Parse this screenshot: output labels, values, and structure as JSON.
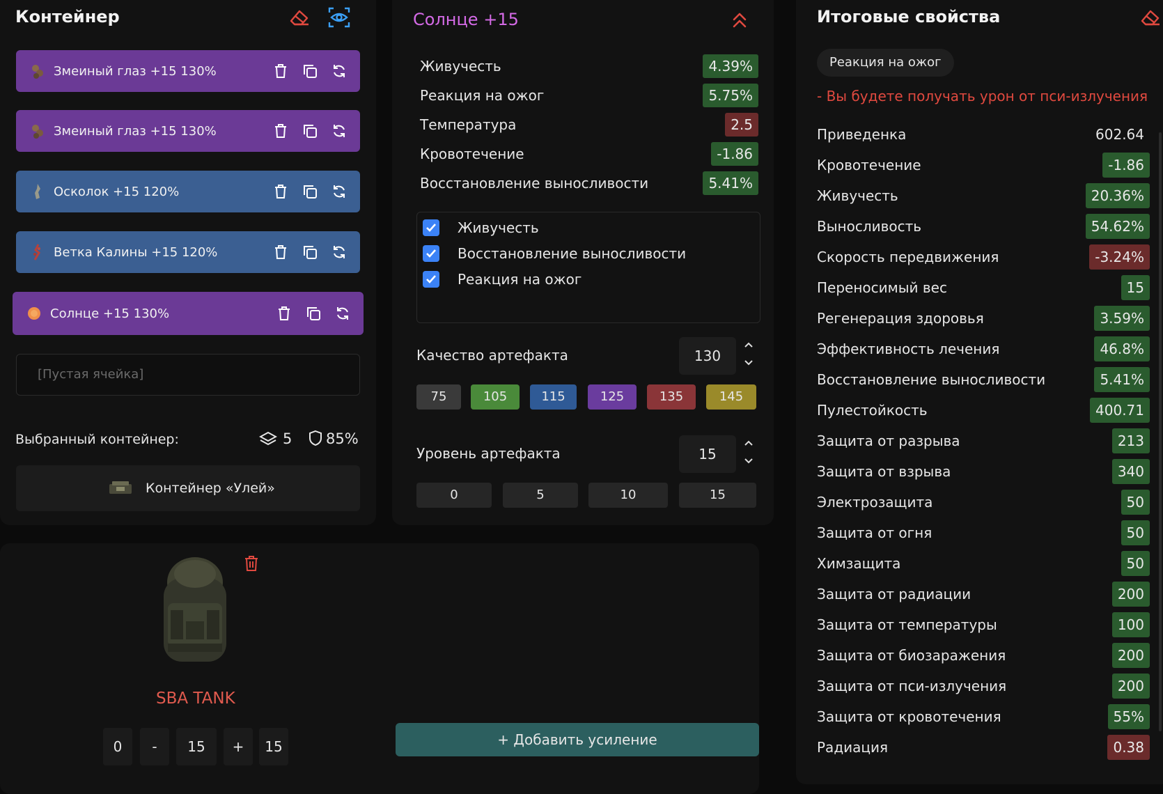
{
  "container_panel": {
    "title": "Контейнер",
    "artifacts": [
      {
        "label": "Змеиный глаз +15 130%",
        "color": "purple"
      },
      {
        "label": "Змеиный глаз +15 130%",
        "color": "purple"
      },
      {
        "label": "Осколок +15 120%",
        "color": "blue"
      },
      {
        "label": "Ветка Калины +15 120%",
        "color": "blue"
      },
      {
        "label": "Солнце +15 130%",
        "color": "purple"
      }
    ],
    "empty_cell": "[Пустая ячейка]",
    "selected_label": "Выбранный контейнер:",
    "slots": "5",
    "protection": "85%",
    "container_name": "Контейнер «Улей»"
  },
  "armor": {
    "name": "SBA TANK",
    "level_min": "0",
    "minus": "-",
    "level": "15",
    "plus": "+",
    "level_max": "15"
  },
  "artifact_panel": {
    "title": "Солнце +15",
    "stats": [
      {
        "name": "Живучесть",
        "value": "4.39%",
        "tone": "good"
      },
      {
        "name": "Реакция на ожог",
        "value": "5.75%",
        "tone": "good"
      },
      {
        "name": "Температура",
        "value": "2.5",
        "tone": "bad"
      },
      {
        "name": "Кровотечение",
        "value": "-1.86",
        "tone": "good"
      },
      {
        "name": "Восстановление выносливости",
        "value": "5.41%",
        "tone": "good"
      }
    ],
    "checks": [
      "Живучесть",
      "Восстановление выносливости",
      "Реакция на ожог"
    ],
    "quality_label": "Качество артефакта",
    "quality_value": "130",
    "quality_presets": [
      "75",
      "105",
      "115",
      "125",
      "135",
      "145"
    ],
    "level_label": "Уровень артефакта",
    "level_value": "15",
    "level_presets": [
      "0",
      "5",
      "10",
      "15"
    ],
    "add_button": "+ Добавить усиление"
  },
  "totals_panel": {
    "title": "Итоговые свойства",
    "tag": "Реакция на ожог",
    "warning": "- Вы будете получать урон от пси-излучения",
    "stats": [
      {
        "name": "Приведенка",
        "value": "602.64",
        "tone": "plain"
      },
      {
        "name": "Кровотечение",
        "value": "-1.86",
        "tone": "good"
      },
      {
        "name": "Живучесть",
        "value": "20.36%",
        "tone": "good"
      },
      {
        "name": "Выносливость",
        "value": "54.62%",
        "tone": "good"
      },
      {
        "name": "Скорость передвижения",
        "value": "-3.24%",
        "tone": "bad"
      },
      {
        "name": "Переносимый вес",
        "value": "15",
        "tone": "good"
      },
      {
        "name": "Регенерация здоровья",
        "value": "3.59%",
        "tone": "good"
      },
      {
        "name": "Эффективность лечения",
        "value": "46.8%",
        "tone": "good"
      },
      {
        "name": "Восстановление выносливости",
        "value": "5.41%",
        "tone": "good"
      },
      {
        "name": "Пулестойкость",
        "value": "400.71",
        "tone": "good"
      },
      {
        "name": "Защита от разрыва",
        "value": "213",
        "tone": "good"
      },
      {
        "name": "Защита от взрыва",
        "value": "340",
        "tone": "good"
      },
      {
        "name": "Электрозащита",
        "value": "50",
        "tone": "good"
      },
      {
        "name": "Защита от огня",
        "value": "50",
        "tone": "good"
      },
      {
        "name": "Химзащита",
        "value": "50",
        "tone": "good"
      },
      {
        "name": "Защита от радиации",
        "value": "200",
        "tone": "good"
      },
      {
        "name": "Защита от температуры",
        "value": "100",
        "tone": "good"
      },
      {
        "name": "Защита от биозаражения",
        "value": "200",
        "tone": "good"
      },
      {
        "name": "Защита от пси-излучения",
        "value": "200",
        "tone": "good"
      },
      {
        "name": "Защита от кровотечения",
        "value": "55%",
        "tone": "good"
      },
      {
        "name": "Радиация",
        "value": "0.38",
        "tone": "bad"
      }
    ]
  }
}
